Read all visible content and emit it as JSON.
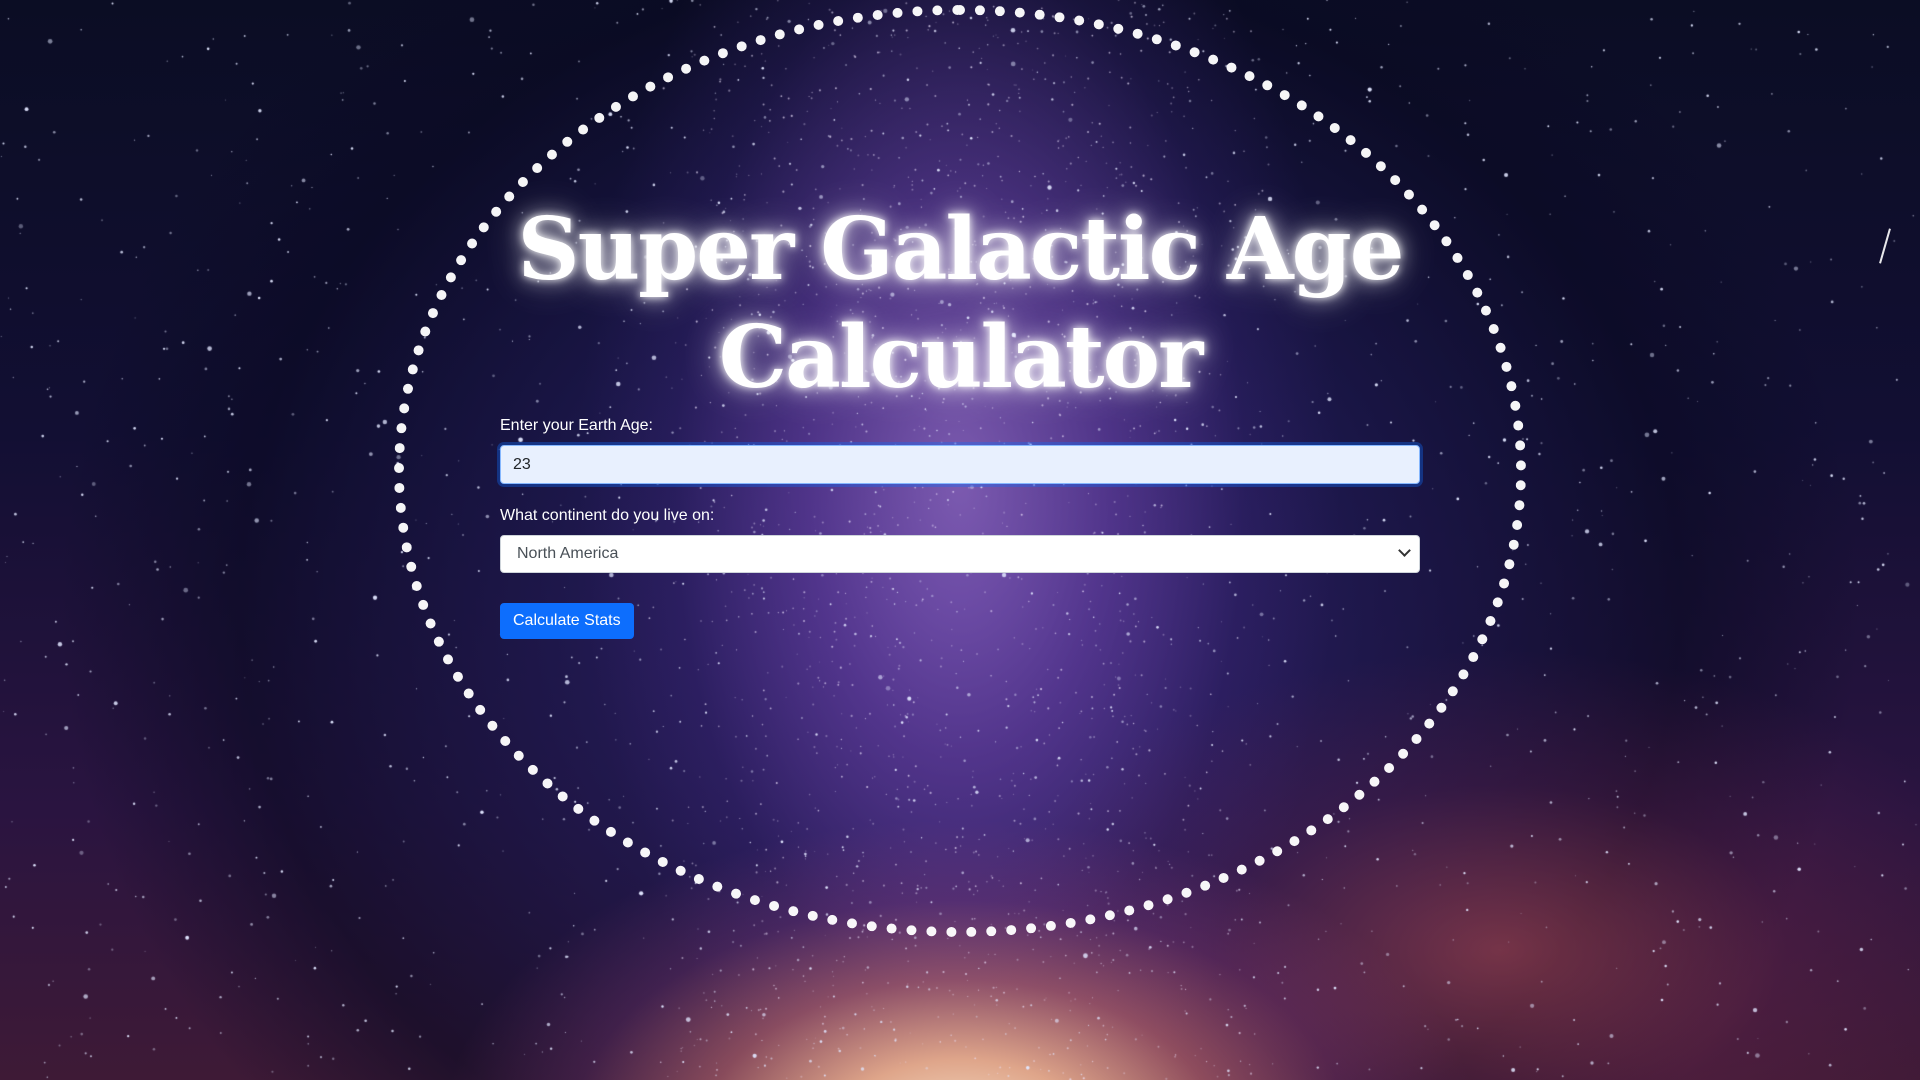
{
  "page": {
    "title": "Super Galactic Age Calculator"
  },
  "form": {
    "age_label": "Enter your Earth Age:",
    "age_value": "23",
    "continent_label": "What continent do you live on:",
    "continent_selected": "North America",
    "submit_label": "Calculate Stats"
  },
  "colors": {
    "accent": "#0d6efd",
    "ring": "#ffffff",
    "input_focus_bg": "#e8f0fe"
  },
  "icons": {
    "select": "chevron-down-icon"
  }
}
